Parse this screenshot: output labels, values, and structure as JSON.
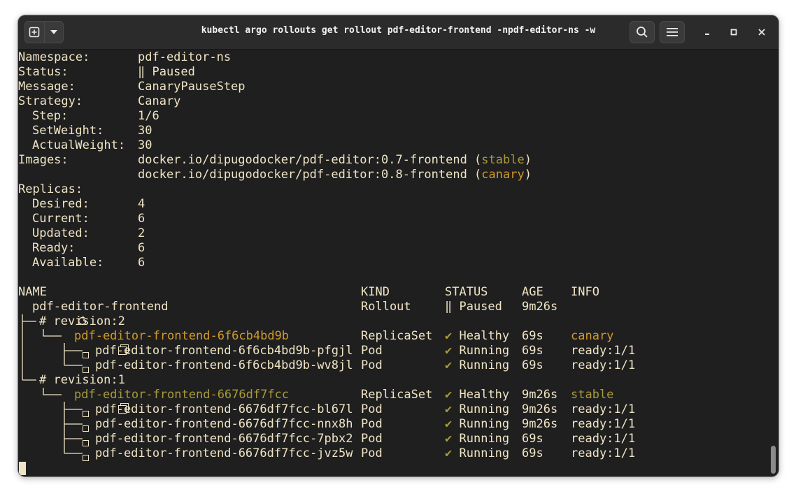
{
  "window": {
    "title": "kubectl argo rollouts get rollout pdf-editor-frontend -npdf-editor-ns -w"
  },
  "summary": {
    "namespace_label": "Namespace:",
    "namespace": "pdf-editor-ns",
    "status_label": "Status:",
    "status": "‖ Paused",
    "message_label": "Message:",
    "message": "CanaryPauseStep",
    "strategy_label": "Strategy:",
    "strategy": "Canary",
    "step_label": "Step:",
    "step": "1/6",
    "setweight_label": "SetWeight:",
    "setweight": "30",
    "actualweight_label": "ActualWeight:",
    "actualweight": "30",
    "images_label": "Images:",
    "image1": "docker.io/dipugodocker/pdf-editor:0.7-frontend",
    "image1_tag": "stable",
    "image2": "docker.io/dipugodocker/pdf-editor:0.8-frontend",
    "image2_tag": "canary",
    "replicas_label": "Replicas:",
    "desired_label": "Desired:",
    "desired": "4",
    "current_label": "Current:",
    "current": "6",
    "updated_label": "Updated:",
    "updated": "2",
    "ready_label": "Ready:",
    "ready": "6",
    "available_label": "Available:",
    "available": "6"
  },
  "table": {
    "headers": {
      "name": "NAME",
      "kind": "KIND",
      "status": "STATUS",
      "age": "AGE",
      "info": "INFO"
    },
    "rows": [
      {
        "name": "pdf-editor-frontend",
        "kind": "Rollout",
        "status": "‖ Paused",
        "age": "9m26s",
        "info": ""
      },
      {
        "name": "# revision:2",
        "kind": "",
        "status": "",
        "age": "",
        "info": ""
      },
      {
        "name": "pdf-editor-frontend-6f6cb4bd9b",
        "kind": "ReplicaSet",
        "status": "Healthy",
        "age": "69s",
        "info": "canary"
      },
      {
        "name": "pdf-editor-frontend-6f6cb4bd9b-pfgjl",
        "kind": "Pod",
        "status": "Running",
        "age": "69s",
        "info": "ready:1/1"
      },
      {
        "name": "pdf-editor-frontend-6f6cb4bd9b-wv8jl",
        "kind": "Pod",
        "status": "Running",
        "age": "69s",
        "info": "ready:1/1"
      },
      {
        "name": "# revision:1",
        "kind": "",
        "status": "",
        "age": "",
        "info": ""
      },
      {
        "name": "pdf-editor-frontend-6676df7fcc",
        "kind": "ReplicaSet",
        "status": "Healthy",
        "age": "9m26s",
        "info": "stable"
      },
      {
        "name": "pdf-editor-frontend-6676df7fcc-bl67l",
        "kind": "Pod",
        "status": "Running",
        "age": "9m26s",
        "info": "ready:1/1"
      },
      {
        "name": "pdf-editor-frontend-6676df7fcc-nnx8h",
        "kind": "Pod",
        "status": "Running",
        "age": "9m26s",
        "info": "ready:1/1"
      },
      {
        "name": "pdf-editor-frontend-6676df7fcc-7pbx2",
        "kind": "Pod",
        "status": "Running",
        "age": "69s",
        "info": "ready:1/1"
      },
      {
        "name": "pdf-editor-frontend-6676df7fcc-jvz5w",
        "kind": "Pod",
        "status": "Running",
        "age": "69s",
        "info": "ready:1/1"
      }
    ],
    "check_glyph": "✔"
  },
  "icons": [
    "new-tab-icon",
    "dropdown-arrow-icon",
    "search-icon",
    "hamburger-menu-icon",
    "minimize-icon",
    "maximize-icon",
    "close-icon"
  ],
  "colors": {
    "background": "#1f1f1f",
    "text": "#efe4c5",
    "stable": "#a89a3a",
    "canary": "#d19a2c"
  }
}
